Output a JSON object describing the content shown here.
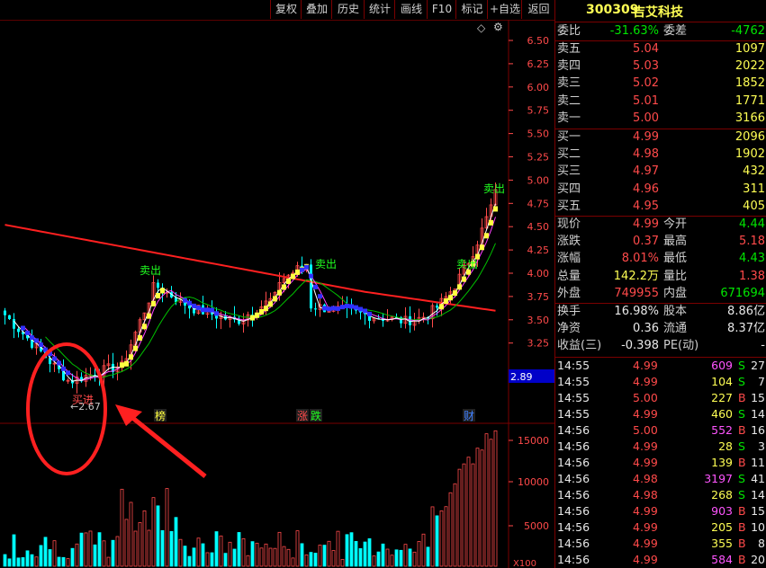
{
  "toolbar": {
    "items": [
      "复权",
      "叠加",
      "历史",
      "统计",
      "画线",
      "F10",
      "标记",
      "+自选",
      "返回"
    ]
  },
  "chart": {
    "price_axis": [
      "6.50",
      "6.25",
      "6.00",
      "5.75",
      "5.50",
      "5.25",
      "5.00",
      "4.75",
      "4.50",
      "4.25",
      "4.00",
      "3.75",
      "3.50",
      "3.25"
    ],
    "current_axis_value": "2.89",
    "volume_axis": [
      "15000",
      "10000",
      "5000"
    ],
    "volume_unit": "X100",
    "low_marker": "←2.67",
    "buy_signal": "买进",
    "sell_signal": "卖出",
    "event_labels": [
      "榜",
      "涨",
      "跌",
      "财"
    ],
    "diamond_icon": "◇",
    "settings_icon": "⚙"
  },
  "stock": {
    "code": "300309",
    "name": "吉艾科技"
  },
  "quote": {
    "weibi_label": "委比",
    "weibi_value": "-31.63%",
    "weicha_label": "委差",
    "weicha_value": "-4762",
    "asks": [
      {
        "label": "卖五",
        "price": "5.04",
        "vol": "1097"
      },
      {
        "label": "卖四",
        "price": "5.03",
        "vol": "2022"
      },
      {
        "label": "卖三",
        "price": "5.02",
        "vol": "1852"
      },
      {
        "label": "卖二",
        "price": "5.01",
        "vol": "1771"
      },
      {
        "label": "卖一",
        "price": "5.00",
        "vol": "3166"
      }
    ],
    "bids": [
      {
        "label": "买一",
        "price": "4.99",
        "vol": "2096"
      },
      {
        "label": "买二",
        "price": "4.98",
        "vol": "1902"
      },
      {
        "label": "买三",
        "price": "4.97",
        "vol": "432"
      },
      {
        "label": "买四",
        "price": "4.96",
        "vol": "311"
      },
      {
        "label": "买五",
        "price": "4.95",
        "vol": "405"
      }
    ],
    "stats": [
      {
        "l1": "现价",
        "v1": "4.99",
        "c1": "red",
        "l2": "今开",
        "v2": "4.44",
        "c2": "green"
      },
      {
        "l1": "涨跌",
        "v1": "0.37",
        "c1": "red",
        "l2": "最高",
        "v2": "5.18",
        "c2": "red"
      },
      {
        "l1": "涨幅",
        "v1": "8.01%",
        "c1": "red",
        "l2": "最低",
        "v2": "4.43",
        "c2": "green"
      },
      {
        "l1": "总量",
        "v1": "142.2万",
        "c1": "yellow",
        "l2": "量比",
        "v2": "1.38",
        "c2": "red"
      },
      {
        "l1": "外盘",
        "v1": "749955",
        "c1": "red",
        "l2": "内盘",
        "v2": "671694",
        "c2": "green"
      }
    ],
    "stats2": [
      {
        "l1": "换手",
        "v1": "16.98%",
        "c1": "white",
        "l2": "股本",
        "v2": "8.86亿",
        "c2": "white"
      },
      {
        "l1": "净资",
        "v1": "0.36",
        "c1": "white",
        "l2": "流通",
        "v2": "8.37亿",
        "c2": "white"
      },
      {
        "l1": "收益(三)",
        "v1": "-0.398",
        "c1": "white",
        "l2": "PE(动)",
        "v2": "-",
        "c2": "white"
      }
    ],
    "ticks": [
      {
        "time": "14:55",
        "price": "4.99",
        "pc": "red",
        "vol": "609",
        "vc": "mag",
        "bs": "S",
        "bc": "green",
        "n": "27"
      },
      {
        "time": "14:55",
        "price": "4.99",
        "pc": "red",
        "vol": "104",
        "vc": "yellow",
        "bs": "S",
        "bc": "green",
        "n": "7"
      },
      {
        "time": "14:55",
        "price": "5.00",
        "pc": "red",
        "vol": "227",
        "vc": "yellow",
        "bs": "B",
        "bc": "red",
        "n": "15"
      },
      {
        "time": "14:55",
        "price": "4.99",
        "pc": "red",
        "vol": "460",
        "vc": "yellow",
        "bs": "S",
        "bc": "green",
        "n": "14"
      },
      {
        "time": "14:56",
        "price": "5.00",
        "pc": "red",
        "vol": "552",
        "vc": "mag",
        "bs": "B",
        "bc": "red",
        "n": "16"
      },
      {
        "time": "14:56",
        "price": "4.99",
        "pc": "red",
        "vol": "28",
        "vc": "yellow",
        "bs": "S",
        "bc": "green",
        "n": "3"
      },
      {
        "time": "14:56",
        "price": "4.99",
        "pc": "red",
        "vol": "139",
        "vc": "yellow",
        "bs": "B",
        "bc": "red",
        "n": "11"
      },
      {
        "time": "14:56",
        "price": "4.98",
        "pc": "red",
        "vol": "3197",
        "vc": "mag",
        "bs": "S",
        "bc": "green",
        "n": "41"
      },
      {
        "time": "14:56",
        "price": "4.98",
        "pc": "red",
        "vol": "268",
        "vc": "yellow",
        "bs": "S",
        "bc": "green",
        "n": "14"
      },
      {
        "time": "14:56",
        "price": "4.99",
        "pc": "red",
        "vol": "903",
        "vc": "mag",
        "bs": "B",
        "bc": "red",
        "n": "15"
      },
      {
        "time": "14:56",
        "price": "4.99",
        "pc": "red",
        "vol": "205",
        "vc": "yellow",
        "bs": "B",
        "bc": "red",
        "n": "10"
      },
      {
        "time": "14:56",
        "price": "4.99",
        "pc": "red",
        "vol": "355",
        "vc": "yellow",
        "bs": "B",
        "bc": "red",
        "n": "8"
      },
      {
        "time": "14:56",
        "price": "4.99",
        "pc": "red",
        "vol": "584",
        "vc": "mag",
        "bs": "B",
        "bc": "red",
        "n": "20"
      }
    ]
  },
  "colors": {
    "up": "#ff4a4a",
    "down": "#00e600",
    "border": "#7a0000",
    "ma_red": "#ff2020",
    "ma_yellow": "#ffff40",
    "ma_blue": "#3030ff"
  }
}
